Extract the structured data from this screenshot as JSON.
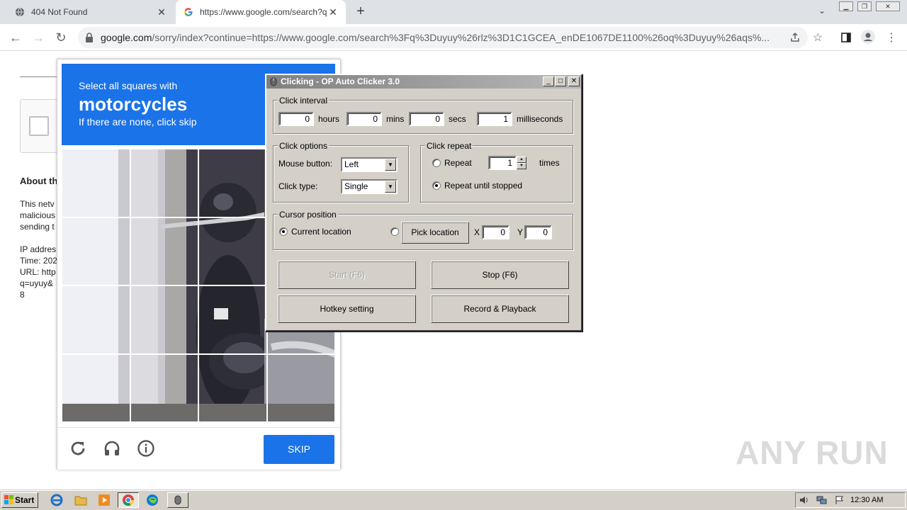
{
  "browser": {
    "tabs": [
      {
        "label": "404 Not Found",
        "icon": "globe-icon"
      },
      {
        "label": "https://www.google.com/search?q=",
        "icon": "google-g-icon"
      }
    ],
    "new_tab": "+",
    "tab_search": "⌄",
    "url_host": "google.com",
    "url_rest": "/sorry/index?continue=https://www.google.com/search%3Fq%3Duyuy%26rlz%3D1C1GCEA_enDE1067DE1100%26oq%3Duyuy%26aqs%..."
  },
  "page_behind": {
    "about": "About th",
    "lines": [
      "This netv",
      "malicious",
      "sending t",
      "",
      "IP addres",
      "Time: 202",
      "URL: http",
      "q=uyuy&",
      "8"
    ]
  },
  "captcha": {
    "instruction": "Select all squares with",
    "target": "motorcycles",
    "hint": "If there are none, click skip",
    "skip_label": "SKIP"
  },
  "autoclicker": {
    "title": "Clicking - OP Auto Clicker 3.0",
    "interval": {
      "label": "Click interval",
      "hours": "0",
      "hours_label": "hours",
      "mins": "0",
      "mins_label": "mins",
      "secs": "0",
      "secs_label": "secs",
      "ms": "1",
      "ms_label": "milliseconds"
    },
    "options": {
      "label": "Click options",
      "mouse_label": "Mouse button:",
      "mouse_value": "Left",
      "type_label": "Click type:",
      "type_value": "Single"
    },
    "repeat": {
      "label": "Click repeat",
      "repeat_label": "Repeat",
      "repeat_count": "1",
      "times_label": "times",
      "until_label": "Repeat until stopped"
    },
    "cursor": {
      "label": "Cursor position",
      "current_label": "Current location",
      "pick_label": "Pick location",
      "x_label": "X",
      "x_value": "0",
      "y_label": "Y",
      "y_value": "0"
    },
    "start_label": "Start (F6)",
    "stop_label": "Stop (F6)",
    "hotkey_label": "Hotkey setting",
    "record_label": "Record & Playback"
  },
  "watermark": "ANY RUN",
  "taskbar": {
    "start_label": "Start",
    "clock": "12:30 AM"
  }
}
